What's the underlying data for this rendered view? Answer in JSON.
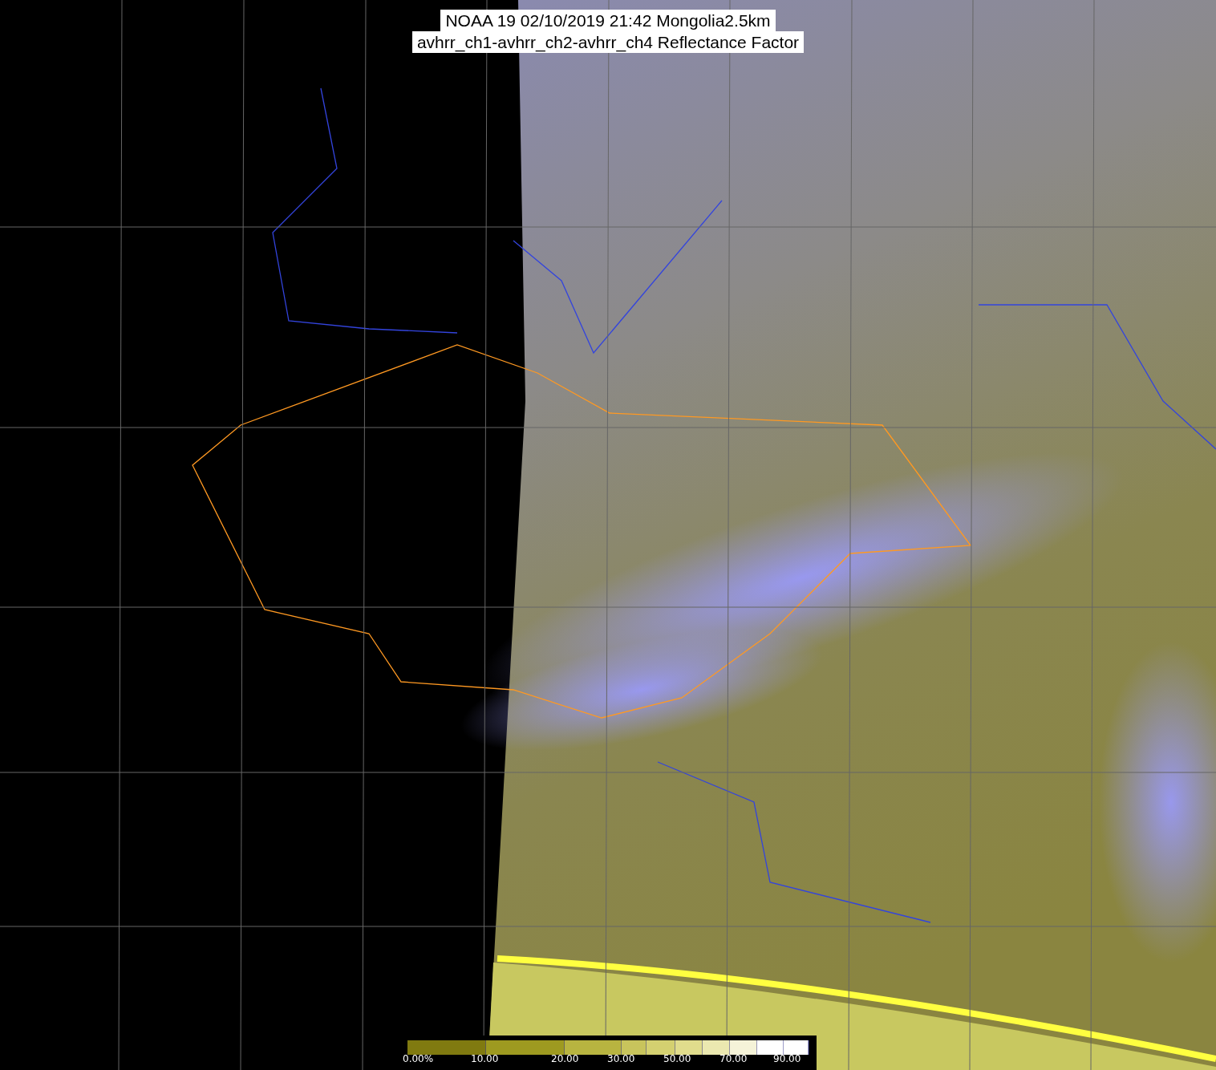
{
  "title_lines": [
    "NOAA 19 02/10/2019 21:42 Mongolia2.5km",
    "avhrr_ch1-avhrr_ch2-avhrr_ch4 Reflectance Factor"
  ],
  "colorbar": {
    "labels": [
      "0.00%",
      "10.00",
      "20.00",
      "30.00",
      "50.00",
      "70.00",
      "90.00"
    ]
  }
}
